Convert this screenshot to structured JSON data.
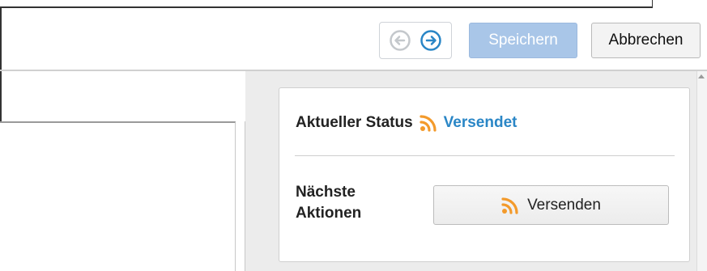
{
  "toolbar": {
    "back_icon": "circle-arrow-left-icon",
    "forward_icon": "circle-arrow-right-icon",
    "save_label": "Speichern",
    "cancel_label": "Abbrechen"
  },
  "status_panel": {
    "status_label": "Aktueller Status",
    "status_icon": "rss-feed-icon",
    "status_value": "Versendet",
    "actions_label": "Nächste\nAktionen",
    "send_button_icon": "rss-feed-icon",
    "send_button_label": "Versenden"
  },
  "colors": {
    "status_accent": "#2a86c6",
    "rss_orange": "#f39a2b",
    "save_button": "#a9c6e8",
    "forward_arrow": "#2a86c6",
    "back_arrow_disabled": "#c4c8cc"
  }
}
